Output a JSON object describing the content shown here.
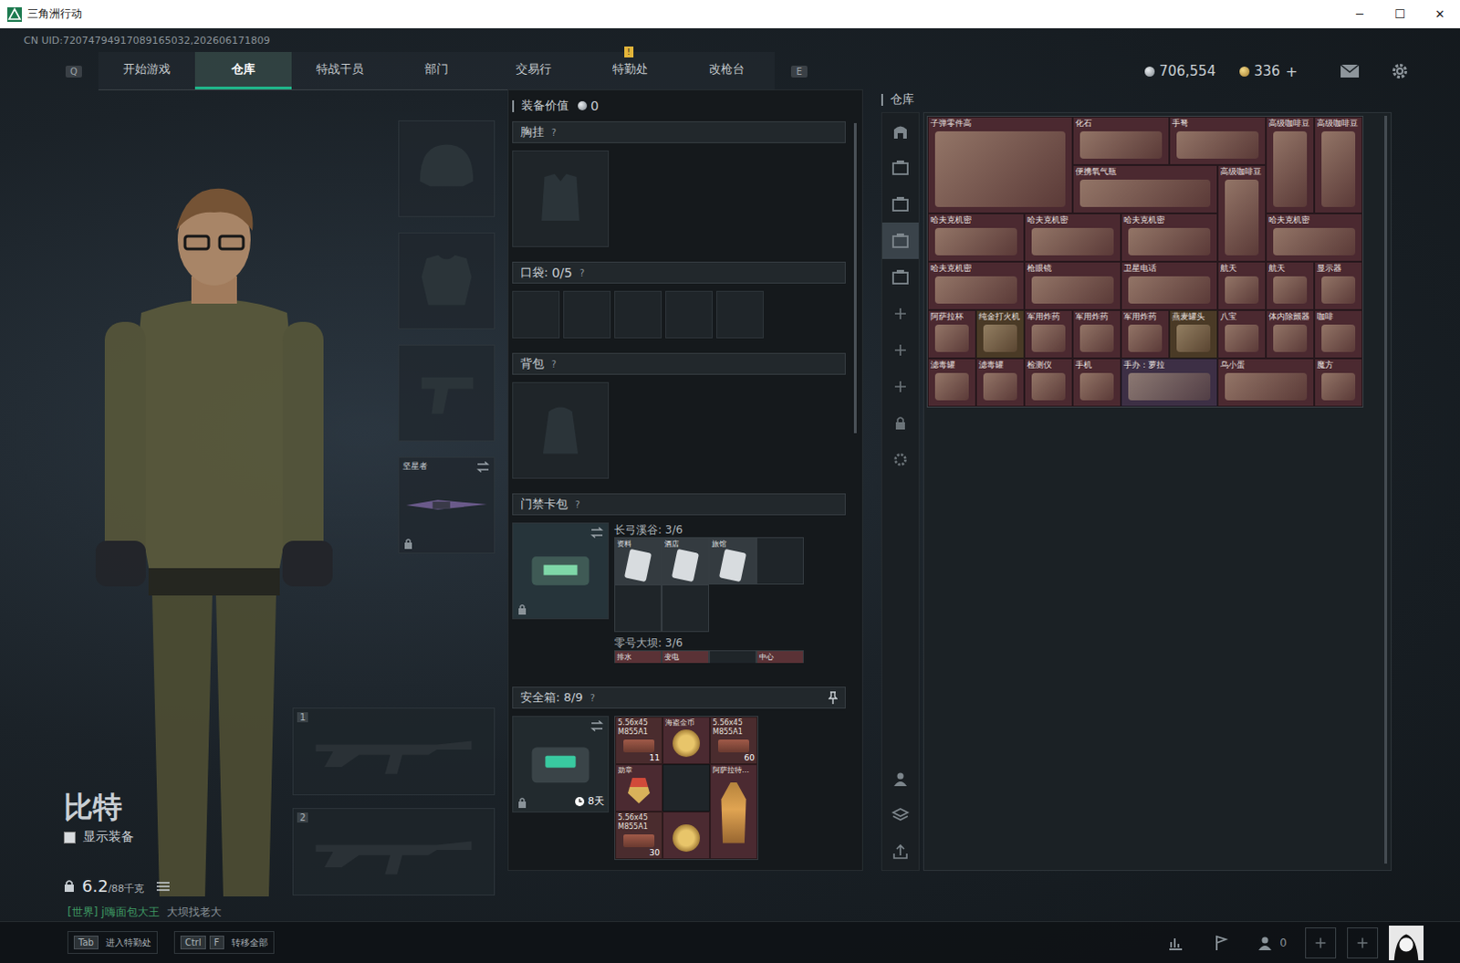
{
  "window": {
    "title": "三角洲行动",
    "controls": [
      "─",
      "☐",
      "✕"
    ]
  },
  "uid": "CN UID:72074794917089165032,202606171809",
  "nav": {
    "prev_key": "Q",
    "next_key": "E",
    "tabs": [
      {
        "label": "开始游戏",
        "selected": false,
        "badge": ""
      },
      {
        "label": "仓库",
        "selected": true,
        "badge": ""
      },
      {
        "label": "特战干员",
        "selected": false,
        "badge": ""
      },
      {
        "label": "部门",
        "selected": false,
        "badge": ""
      },
      {
        "label": "交易行",
        "selected": false,
        "badge": ""
      },
      {
        "label": "特勤处",
        "selected": false,
        "badge": "!"
      },
      {
        "label": "改枪台",
        "selected": false,
        "badge": ""
      }
    ]
  },
  "currency": [
    {
      "kind": "silver",
      "value": "706,554",
      "action": ""
    },
    {
      "kind": "gold",
      "value": "336",
      "action": "+"
    }
  ],
  "character": {
    "name": "比特",
    "show_equipment": {
      "label": "显示装备",
      "checked": false
    },
    "weight": {
      "current": "6.2",
      "max": "/88千克"
    },
    "chat": {
      "channel": "[世界] j嗨面包大王",
      "message": "大坝找老大"
    }
  },
  "equipment_slots": [
    {
      "kind": "helmet",
      "label": "",
      "locked": false
    },
    {
      "kind": "armor",
      "label": "",
      "locked": false
    },
    {
      "kind": "pistol",
      "label": "",
      "locked": false
    },
    {
      "kind": "melee",
      "label": "坚星者",
      "locked": true
    }
  ],
  "weapons": [
    {
      "number": "1"
    },
    {
      "number": "2"
    }
  ],
  "loadout": {
    "value_label": "装备价值",
    "value": "0",
    "chest_rig": {
      "title": "胸挂",
      "help": "?"
    },
    "pockets": {
      "title": "口袋:",
      "count": "0/5",
      "help": "?",
      "slots": [
        {
          "filled": false
        },
        {
          "filled": false
        },
        {
          "filled": false
        },
        {
          "filled": false
        },
        {
          "filled": false
        }
      ]
    },
    "backpack": {
      "title": "背包",
      "help": "?"
    },
    "keycard": {
      "title": "门禁卡包",
      "help": "?",
      "locked": true,
      "maps": [
        {
          "name": "长弓溪谷: 3/6",
          "cards": [
            {
              "label": "资料",
              "filled": true
            },
            {
              "label": "酒店",
              "filled": true
            },
            {
              "label": "旅馆",
              "filled": true
            },
            {
              "label": "",
              "filled": false
            },
            {
              "label": "",
              "filled": false
            },
            {
              "label": "",
              "filled": false
            }
          ]
        },
        {
          "name": "零号大坝: 3/6",
          "cards": [
            {
              "label": "排水",
              "filled": true
            },
            {
              "label": "变电",
              "filled": true
            },
            {
              "label": "",
              "filled": false
            },
            {
              "label": "中心",
              "filled": true
            }
          ]
        }
      ]
    },
    "safe_box": {
      "title": "安全箱: 8/9",
      "help": "?",
      "timer": "8天",
      "locked": true,
      "items": [
        {
          "kind": "ammo",
          "label": "5.56x45 M855A1",
          "count": "11",
          "color": "#4a2c2e"
        },
        {
          "kind": "coin",
          "label": "海盗金币",
          "count": "",
          "color": "#4b2a31"
        },
        {
          "kind": "ammo",
          "label": "5.56x45 M855A1",
          "count": "60",
          "color": "#4a2c2e"
        },
        {
          "kind": "medal",
          "label": "勋章",
          "count": "",
          "color": "#4b2a31"
        },
        {
          "kind": "empty",
          "label": "",
          "count": "",
          "color": "#1f2529"
        },
        {
          "kind": "lamp",
          "label": "阿萨拉特…",
          "count": "",
          "color": "#4b2a31"
        },
        {
          "kind": "ammo",
          "label": "5.56x45 M855A1",
          "count": "30",
          "color": "#4a2c2e"
        },
        {
          "kind": "coin",
          "label": "",
          "count": "",
          "color": "#4b2a31"
        }
      ]
    }
  },
  "warehouse": {
    "title": "仓库",
    "side_tabs": [
      {
        "kind": "all",
        "selected": false
      },
      {
        "kind": "tab",
        "selected": false
      },
      {
        "kind": "tab",
        "selected": false
      },
      {
        "kind": "tab",
        "selected": true
      },
      {
        "kind": "tab",
        "selected": false
      },
      {
        "kind": "add",
        "selected": false
      },
      {
        "kind": "add",
        "selected": false
      },
      {
        "kind": "add",
        "selected": false
      },
      {
        "kind": "lock",
        "selected": false
      },
      {
        "kind": "settings",
        "selected": false
      }
    ],
    "bottom_tabs": [
      {
        "kind": "person"
      },
      {
        "kind": "layers"
      },
      {
        "kind": "upload"
      }
    ],
    "items": [
      {
        "label": "子弹零件高",
        "color": "#4b2930"
      },
      {
        "label": "化石",
        "color": "#4b2930"
      },
      {
        "label": "手弩",
        "color": "#4b2930"
      },
      {
        "label": "高级咖啡豆",
        "color": "#4b2930"
      },
      {
        "label": "高级咖啡豆",
        "color": "#4b2930"
      },
      {
        "label": "便携氧气瓶",
        "color": "#4b2930"
      },
      {
        "label": "高级咖啡豆",
        "color": "#4b2930"
      },
      {
        "label": "哈夫克机密",
        "color": "#4b2930"
      },
      {
        "label": "哈夫克机密",
        "color": "#4b2930"
      },
      {
        "label": "哈夫克机密",
        "color": "#4b2930"
      },
      {
        "label": "哈夫克机密",
        "color": "#4b2930"
      },
      {
        "label": "哈夫克机密",
        "color": "#4b2930"
      },
      {
        "label": "枪眼镜",
        "color": "#4b2930"
      },
      {
        "label": "卫星电话",
        "color": "#4b2930"
      },
      {
        "label": "航天",
        "color": "#4b2930"
      },
      {
        "label": "航天",
        "color": "#4b2930"
      },
      {
        "label": "显示器",
        "color": "#4b2930"
      },
      {
        "label": "阿萨拉杯",
        "color": "#4b2930"
      },
      {
        "label": "纯金打火机",
        "color": "#4a3a26"
      },
      {
        "label": "军用炸药",
        "color": "#4b2930"
      },
      {
        "label": "军用炸药",
        "color": "#4b2930"
      },
      {
        "label": "军用炸药",
        "color": "#4b2930"
      },
      {
        "label": "燕麦罐头",
        "color": "#4a3a26"
      },
      {
        "label": "八宝",
        "color": "#4b2930"
      },
      {
        "label": "体内除颤器",
        "color": "#4b2930"
      },
      {
        "label": "咖啡",
        "color": "#4b2930"
      },
      {
        "label": "滤毒罐",
        "color": "#4b2930"
      },
      {
        "label": "滤毒罐",
        "color": "#4b2930"
      },
      {
        "label": "检测仪",
        "color": "#4b2930"
      },
      {
        "label": "手机",
        "color": "#4b2930"
      },
      {
        "label": "手办：萝拉",
        "color": "#3d2f45"
      },
      {
        "label": "乌小蛋",
        "color": "#4b2930"
      },
      {
        "label": "魔方",
        "color": "#4b2930"
      }
    ]
  },
  "bottom_bar": {
    "hints": [
      {
        "keys": [
          "Tab"
        ],
        "label": "进入特勤处"
      },
      {
        "keys": [
          "Ctrl",
          "F"
        ],
        "label": "转移全部"
      }
    ],
    "friends": "0"
  }
}
